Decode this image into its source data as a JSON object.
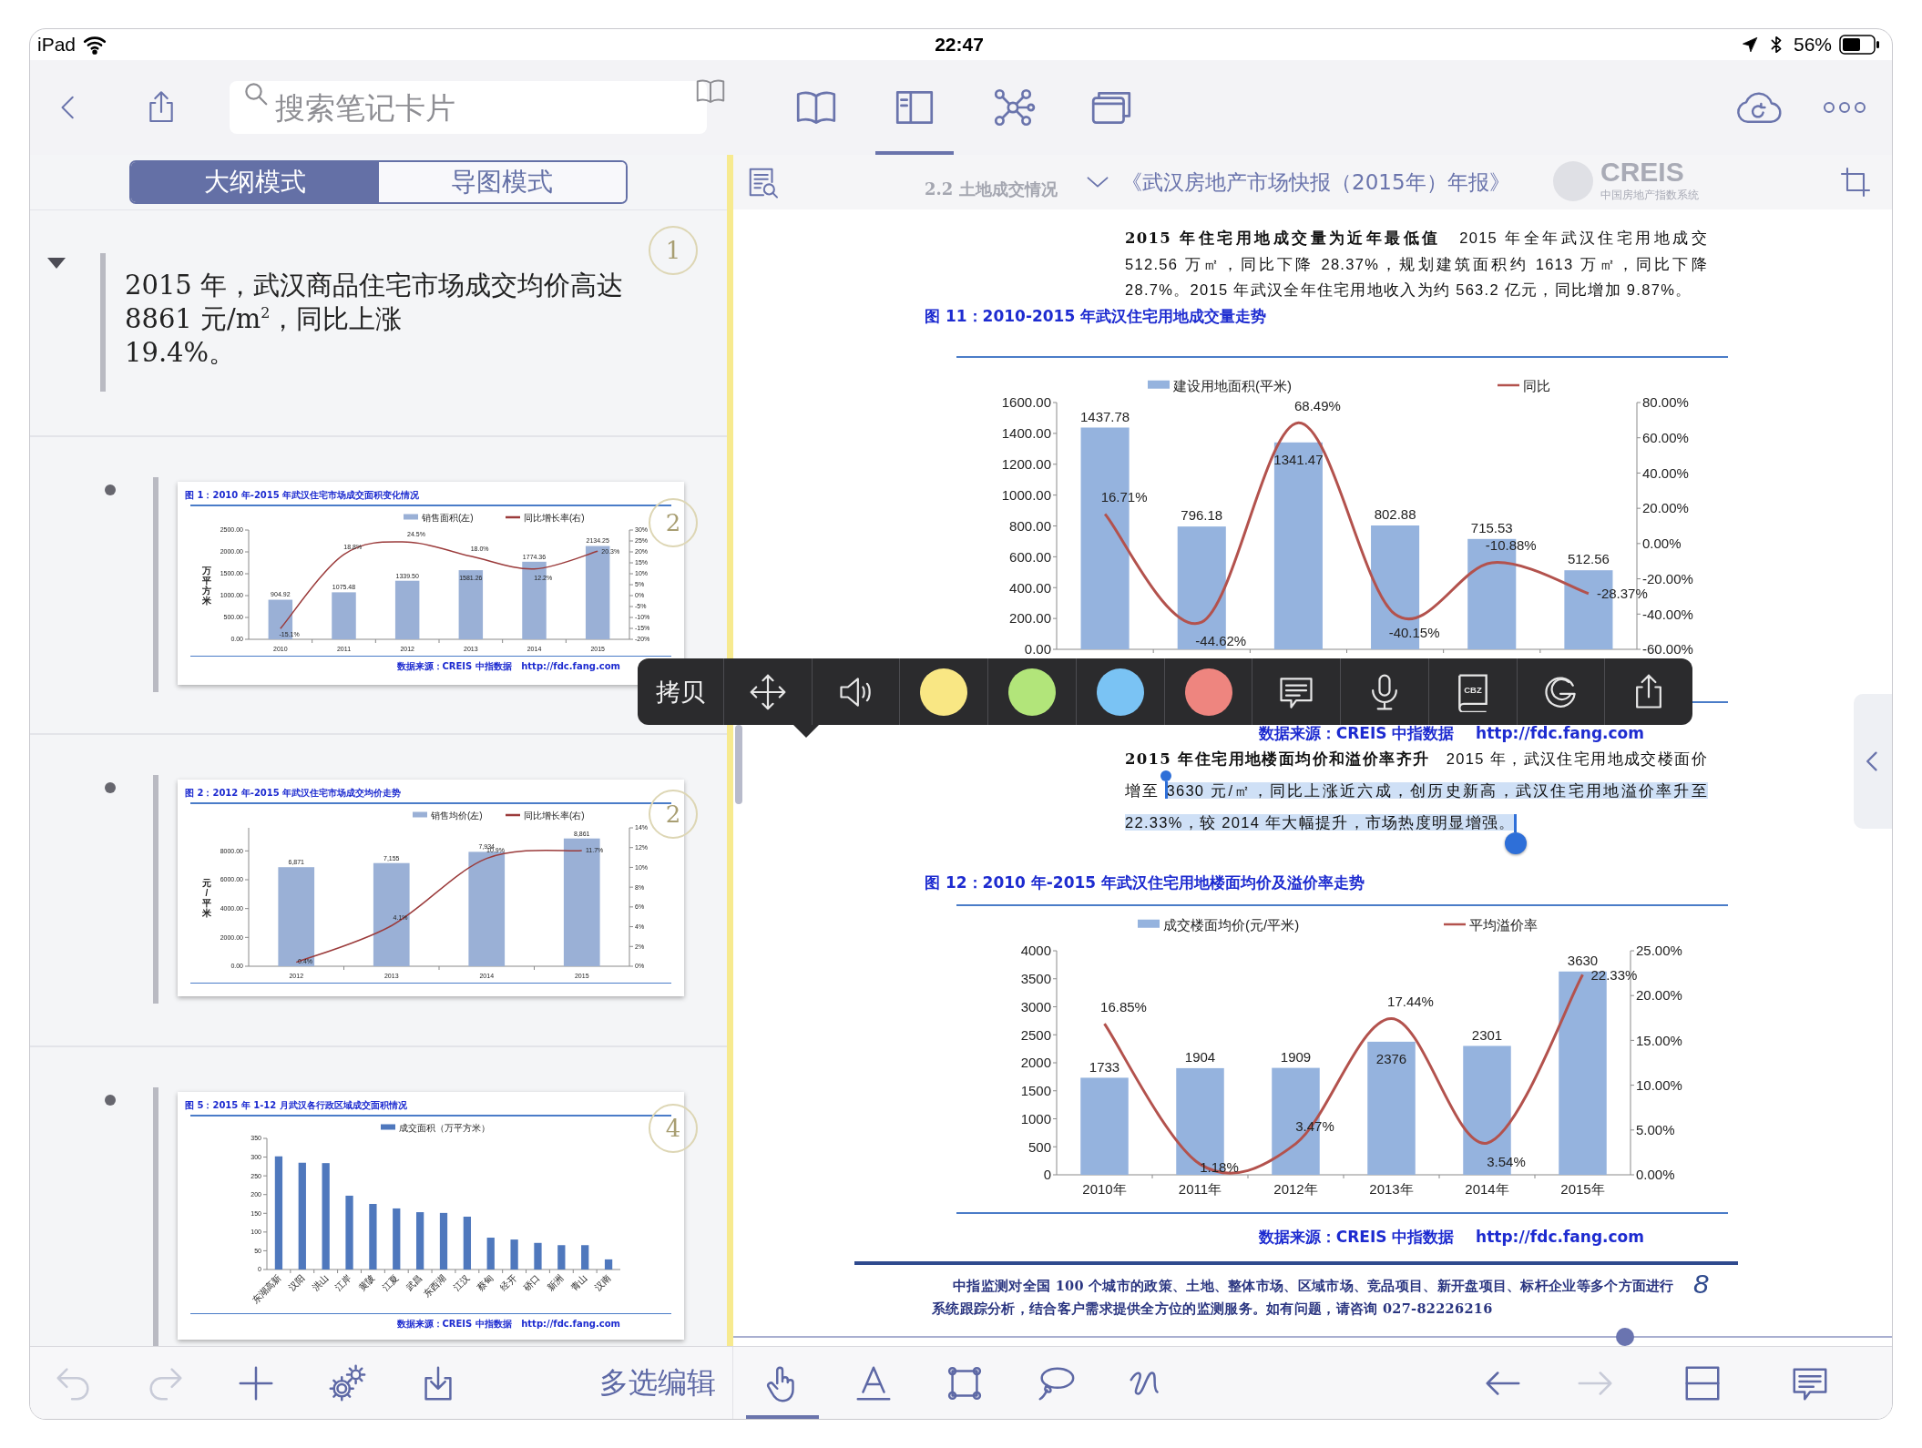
{
  "status_bar": {
    "device": "iPad",
    "time": "22:47",
    "battery": "56%"
  },
  "nav_bar": {
    "search_placeholder": "搜索笔记卡片",
    "views": [
      {
        "kind": "book",
        "selected": false
      },
      {
        "kind": "outline",
        "selected": true
      },
      {
        "kind": "mindmap",
        "selected": false
      },
      {
        "kind": "cards",
        "selected": false
      }
    ]
  },
  "outline": {
    "modes": [
      {
        "label": "大纲模式",
        "selected": true
      },
      {
        "label": "导图模式",
        "selected": false
      }
    ],
    "items": [
      {
        "kind": "text",
        "expanded": true,
        "number": "1",
        "text": "2015 年，武汉商品住宅市场成交均价高达\n8861 元/m$^{2}$，同比上涨\n19.4%。"
      },
      {
        "kind": "excerpt",
        "number": "2",
        "title": "图 1：2010 年-2015 年武汉住宅市场成交面积变化情况",
        "source": "数据来源：CREIS 中指数据   http://fdc.fang.com",
        "chart_data": {
          "type": "bar",
          "legend": "top",
          "ylabel": "万平方米",
          "categories": [
            "2010",
            "2011",
            "2012",
            "2013",
            "2014",
            "2015"
          ],
          "series": [
            {
              "name": "销售面积(左)",
              "color": "#9ab0d6",
              "values": [
                904.92,
                1075.48,
                1339.5,
                1581.26,
                1774.36,
                2134.25
              ],
              "value_labels": [
                "904.92",
                "1075.48",
                "1339.50",
                "1581.26",
                "1774.36",
                "2134.25"
              ]
            },
            {
              "name": "同比增长率(右)",
              "color": "#9b3b3b",
              "type": "line",
              "axis": "y2",
              "values": [
                -15.1,
                18.8,
                24.5,
                18.0,
                12.2,
                20.3
              ],
              "value_labels": [
                "-15.1%",
                "18.8%",
                "24.5%",
                "18.0%",
                "12.2%",
                "20.3%"
              ]
            }
          ],
          "ylim": [
            0,
            2500
          ],
          "yticks": [
            {
              "value": 0,
              "label": "0.00"
            },
            {
              "value": 500,
              "label": "500.00"
            },
            {
              "value": 1000,
              "label": "1000.00"
            },
            {
              "value": 1500,
              "label": "1500.00"
            },
            {
              "value": 2000,
              "label": "2000.00"
            },
            {
              "value": 2500,
              "label": "2500.00"
            }
          ],
          "y2lim": [
            -20,
            30
          ],
          "y2ticks": [
            {
              "value": -20,
              "label": "-20%"
            },
            {
              "value": -15,
              "label": "-15%"
            },
            {
              "value": -10,
              "label": "-10%"
            },
            {
              "value": -5,
              "label": "-5%"
            },
            {
              "value": 0,
              "label": "0%"
            },
            {
              "value": 5,
              "label": "5%"
            },
            {
              "value": 10,
              "label": "10%"
            },
            {
              "value": 15,
              "label": "15%"
            },
            {
              "value": 20,
              "label": "20%"
            },
            {
              "value": 25,
              "label": "25%"
            },
            {
              "value": 30,
              "label": "30%"
            }
          ]
        }
      },
      {
        "kind": "excerpt",
        "number": "2",
        "title": "图 2：2012 年-2015 年武汉住宅市场成交均价走势",
        "chart_data": {
          "type": "bar",
          "legend": "top",
          "ylabel": "元/平米",
          "categories": [
            "2012",
            "2013",
            "2014",
            "2015"
          ],
          "series": [
            {
              "name": "销售均价(左)",
              "color": "#9ab0d6",
              "values": [
                6871,
                7155,
                7934,
                8861
              ],
              "value_labels": [
                "6,871",
                "7,155",
                "7,934",
                "8,861"
              ]
            },
            {
              "name": "同比增长率(右)",
              "color": "#9b3b3b",
              "type": "line",
              "axis": "y2",
              "values": [
                0.4,
                4.1,
                10.9,
                11.7
              ],
              "value_labels": [
                "0.4%",
                "4.1%",
                "10.9%",
                "11.7%"
              ]
            }
          ],
          "ylim": [
            0,
            9600
          ],
          "yticks": [
            {
              "value": 0,
              "label": "0.00"
            },
            {
              "value": 2000,
              "label": "2000.00"
            },
            {
              "value": 4000,
              "label": "4000.00"
            },
            {
              "value": 6000,
              "label": "6000.00"
            },
            {
              "value": 8000,
              "label": "8000.00"
            }
          ],
          "y2lim": [
            0,
            14
          ],
          "y2ticks": [
            {
              "value": 0,
              "label": "0%"
            },
            {
              "value": 2,
              "label": "2%"
            },
            {
              "value": 4,
              "label": "4%"
            },
            {
              "value": 6,
              "label": "6%"
            },
            {
              "value": 8,
              "label": "8%"
            },
            {
              "value": 10,
              "label": "10%"
            },
            {
              "value": 12,
              "label": "12%"
            },
            {
              "value": 14,
              "label": "14%"
            }
          ]
        }
      },
      {
        "kind": "excerpt",
        "number": "4",
        "title": "图 5：2015 年 1-12 月武汉各行政区域成交面积情况",
        "source": "数据来源：CREIS 中指数据   http://fdc.fang.com",
        "chart_data": {
          "type": "bar",
          "legend": "top",
          "categories": [
            "东湖高新",
            "汉阳",
            "洪山",
            "江岸",
            "黄陂",
            "江夏",
            "武昌",
            "东西湖",
            "江汉",
            "蔡甸",
            "经开",
            "硚口",
            "新洲",
            "青山",
            "汉南"
          ],
          "series": [
            {
              "name": "成交面积（万平方米）",
              "color": "#4f78bd",
              "values": [
                302,
                285,
                284,
                197,
                175,
                163,
                153,
                151,
                141,
                85,
                80,
                71,
                65,
                65,
                27
              ]
            }
          ],
          "ylim": [
            0,
            350
          ],
          "yticks": [
            0,
            50,
            100,
            150,
            200,
            250,
            300,
            350
          ]
        }
      }
    ]
  },
  "document": {
    "header": {
      "section": "2.2 土地成交情况",
      "logo": "CREIS",
      "logo_caption": "中国房地产指数系统",
      "title": "《武汉房地产市场快报（2015年）年报》"
    },
    "blocks": [
      {
        "kind": "paragraph",
        "text": "**2015 年住宅用地成交量为近年最低值**　2015 年全年武汉住宅用地成交 512.56 万㎡，同比下降 28.37%，规划建筑面积约 1613 万㎡，同比下降 28.7%。2015 年武汉全年住宅用地收入为约 563.2 亿元，同比增加 9.87%。"
      },
      {
        "kind": "figure",
        "title": "图 11：2010-2015 年武汉住宅用地成交量走势",
        "source": "数据来源：CREIS 中指数据    http://fdc.fang.com",
        "chart_data": {
          "type": "bar",
          "legend": "top",
          "categories": [
            null,
            null,
            null,
            null,
            null,
            null
          ],
          "series": [
            {
              "name": "建设用地面积(平米)",
              "color": "#95b3de",
              "values": [
                1437.78,
                796.18,
                1341.47,
                802.88,
                715.53,
                512.56
              ],
              "value_labels": [
                "1437.78",
                "796.18",
                "1341.47",
                "802.88",
                "715.53",
                "512.56"
              ]
            },
            {
              "name": "同比",
              "color": "#b3524d",
              "type": "line",
              "axis": "y2",
              "values": [
                16.71,
                -44.62,
                68.49,
                -40.15,
                -10.88,
                -28.37
              ],
              "value_labels": [
                "16.71%",
                "-44.62%",
                "68.49%",
                "-40.15%",
                "-10.88%",
                "-28.37%"
              ]
            }
          ],
          "ylim": [
            0,
            1600
          ],
          "yticks": [
            {
              "value": 0,
              "label": "0.00"
            },
            {
              "value": 200,
              "label": "200.00"
            },
            {
              "value": 400,
              "label": "400.00"
            },
            {
              "value": 600,
              "label": "600.00"
            },
            {
              "value": 800,
              "label": "800.00"
            },
            {
              "value": 1000,
              "label": "1000.00"
            },
            {
              "value": 1200,
              "label": "1200.00"
            },
            {
              "value": 1400,
              "label": "1400.00"
            },
            {
              "value": 1600,
              "label": "1600.00"
            }
          ],
          "y2lim": [
            -60,
            80
          ],
          "y2ticks": [
            {
              "value": -60,
              "label": "-60.00%"
            },
            {
              "value": -40,
              "label": "-40.00%"
            },
            {
              "value": -20,
              "label": "-20.00%"
            },
            {
              "value": 0,
              "label": "0.00%"
            },
            {
              "value": 20,
              "label": "20.00%"
            },
            {
              "value": 40,
              "label": "40.00%"
            },
            {
              "value": 60,
              "label": "60.00%"
            },
            {
              "value": 80,
              "label": "80.00%"
            }
          ]
        }
      },
      {
        "kind": "paragraph",
        "text": "**2015 年住宅用地楼面均价和溢价率齐升**　2015 年，武汉住宅用地成交楼面价增至 ",
        "selected_text": "3630 元/㎡，同比上涨近六成，创历史新高，武汉住宅用地溢价率升至 22.33%，较 2014 年大幅提升，市场热度明显增强。"
      },
      {
        "kind": "figure",
        "title": "图 12：2010 年-2015 年武汉住宅用地楼面均价及溢价率走势",
        "source": "数据来源：CREIS 中指数据    http://fdc.fang.com",
        "chart_data": {
          "type": "bar",
          "legend": "top",
          "categories": [
            "2010年",
            "2011年",
            "2012年",
            "2013年",
            "2014年",
            "2015年"
          ],
          "series": [
            {
              "name": "成交楼面均价(元/平米)",
              "color": "#95b3de",
              "values": [
                1733,
                1904,
                1909,
                2376,
                2301,
                3630
              ],
              "value_labels": [
                "1733",
                "1904",
                "1909",
                "2376",
                "2301",
                "3630"
              ]
            },
            {
              "name": "平均溢价率",
              "color": "#b3524d",
              "type": "line",
              "axis": "y2",
              "values": [
                16.85,
                1.18,
                3.47,
                17.44,
                3.54,
                22.33
              ],
              "value_labels": [
                "16.85%",
                "1.18%",
                "3.47%",
                "17.44%",
                "3.54%",
                "22.33%"
              ]
            }
          ],
          "ylim": [
            0,
            4000
          ],
          "yticks": [
            0,
            500,
            1000,
            1500,
            2000,
            2500,
            3000,
            3500,
            4000
          ],
          "y2lim": [
            0,
            25
          ],
          "y2ticks": [
            {
              "value": 0,
              "label": "0.00%"
            },
            {
              "value": 5,
              "label": "5.00%"
            },
            {
              "value": 10,
              "label": "10.00%"
            },
            {
              "value": 15,
              "label": "15.00%"
            },
            {
              "value": 20,
              "label": "20.00%"
            },
            {
              "value": 25,
              "label": "25.00%"
            }
          ]
        }
      }
    ],
    "footer": {
      "text": "中指监测对全国 100 个城市的政策、土地、整体市场、区域市场、竞品项目、新开盘项目、标杆企业等多个方面进行系统跟踪分析，结合客户需求提供全方位的监测服务。如有问题，请咨询 027-82226216",
      "page": "8"
    },
    "page_slider": {
      "level": 0.77
    }
  },
  "popup_menu": {
    "items": [
      {
        "kind": "copy",
        "label": "拷贝"
      },
      {
        "kind": "move"
      },
      {
        "kind": "speak"
      },
      {
        "kind": "color",
        "color": "#f9e784"
      },
      {
        "kind": "color",
        "color": "#b2e57a"
      },
      {
        "kind": "color",
        "color": "#7ac3f4"
      },
      {
        "kind": "color",
        "color": "#ee857f"
      },
      {
        "kind": "comment"
      },
      {
        "kind": "voice"
      },
      {
        "kind": "cbz",
        "label": "CBZ"
      },
      {
        "kind": "g"
      },
      {
        "kind": "share"
      }
    ]
  },
  "toolbar": {
    "edit": [
      {
        "kind": "undo",
        "disabled": true
      },
      {
        "kind": "redo",
        "disabled": true
      },
      {
        "kind": "add",
        "disabled": false
      },
      {
        "kind": "settings",
        "disabled": false
      },
      {
        "kind": "import",
        "disabled": false
      }
    ],
    "multi_select": "多选编辑",
    "tools": [
      {
        "kind": "hand",
        "selected": true
      },
      {
        "kind": "text",
        "selected": false
      },
      {
        "kind": "select",
        "selected": false
      },
      {
        "kind": "lasso",
        "selected": false
      },
      {
        "kind": "pen",
        "selected": false
      }
    ],
    "navigation": [
      {
        "kind": "back",
        "disabled": false
      },
      {
        "kind": "forward",
        "disabled": true
      }
    ],
    "actions": [
      {
        "kind": "layout"
      },
      {
        "kind": "comment"
      }
    ]
  }
}
